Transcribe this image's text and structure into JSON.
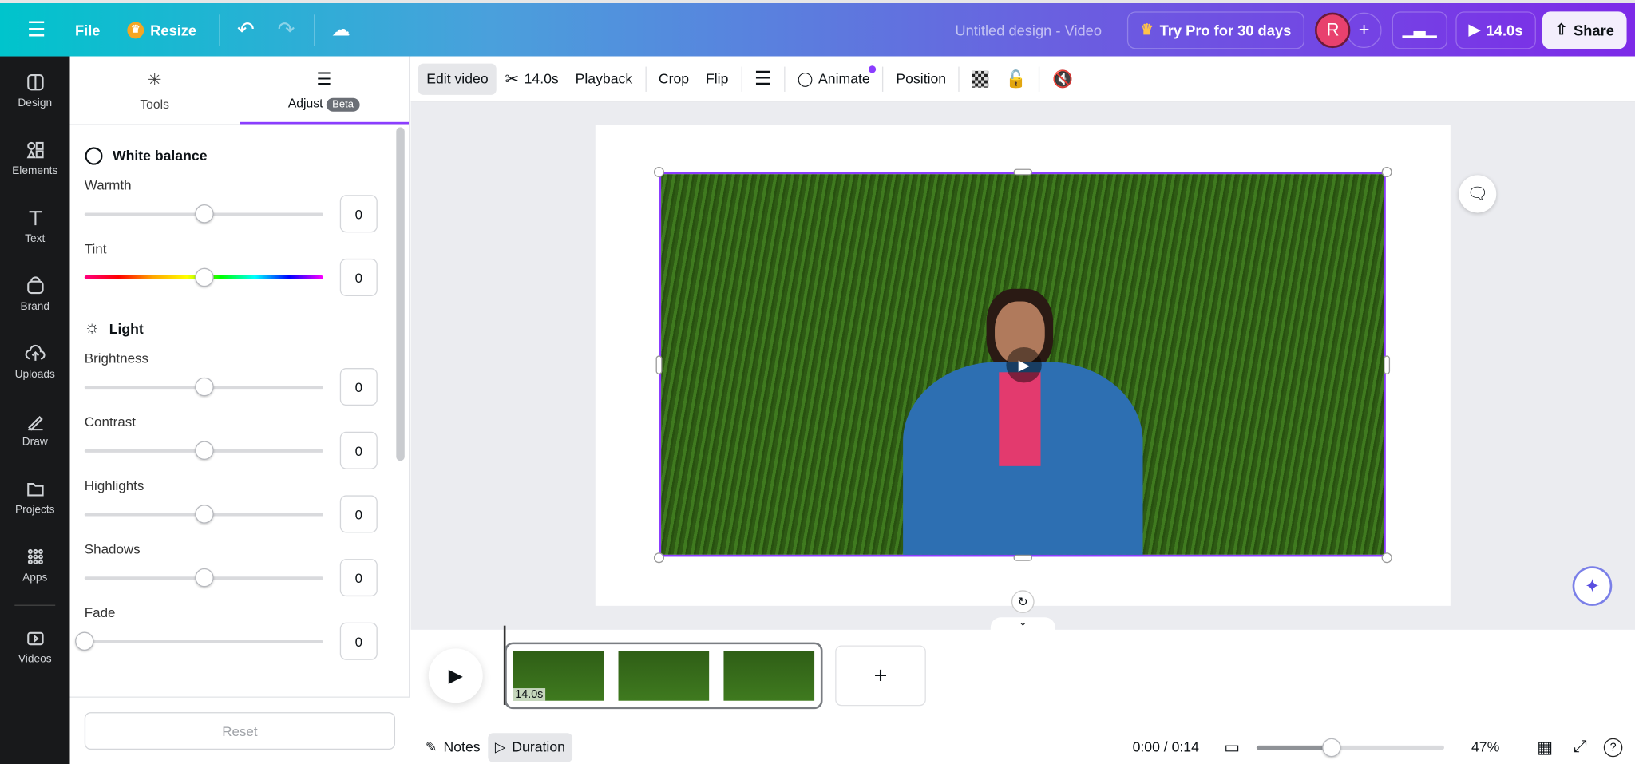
{
  "topbar": {
    "menu_icon": "hamburger-icon",
    "file": "File",
    "resize": "Resize",
    "title": "Untitled design - Video",
    "try_pro": "Try Pro for 30 days",
    "avatar_initial": "R",
    "play_duration": "14.0s",
    "share": "Share"
  },
  "rail": [
    {
      "label": "Design",
      "icon": "design-icon"
    },
    {
      "label": "Elements",
      "icon": "elements-icon"
    },
    {
      "label": "Text",
      "icon": "text-icon"
    },
    {
      "label": "Brand",
      "icon": "brand-icon"
    },
    {
      "label": "Uploads",
      "icon": "upload-icon"
    },
    {
      "label": "Draw",
      "icon": "draw-icon"
    },
    {
      "label": "Projects",
      "icon": "folder-icon"
    },
    {
      "label": "Apps",
      "icon": "apps-icon"
    },
    {
      "label": "Videos",
      "icon": "video-icon"
    }
  ],
  "panel": {
    "tabs": [
      {
        "label": "Tools"
      },
      {
        "label": "Adjust",
        "badge": "Beta"
      }
    ],
    "white_balance": "White balance",
    "light": "Light",
    "sliders": [
      {
        "label": "Warmth",
        "value": "0",
        "level": 0.5
      },
      {
        "label": "Tint",
        "value": "0",
        "level": 0.5
      },
      {
        "label": "Brightness",
        "value": "0",
        "level": 0.5
      },
      {
        "label": "Contrast",
        "value": "0",
        "level": 0.5
      },
      {
        "label": "Highlights",
        "value": "0",
        "level": 0.5
      },
      {
        "label": "Shadows",
        "value": "0",
        "level": 0.5
      },
      {
        "label": "Fade",
        "value": "0",
        "level": 0
      }
    ],
    "reset": "Reset"
  },
  "context_toolbar": {
    "edit_video": "Edit video",
    "trim_duration": "14.0s",
    "playback": "Playback",
    "crop": "Crop",
    "flip": "Flip",
    "animate": "Animate",
    "position": "Position"
  },
  "timeline": {
    "clip_duration": "14.0s"
  },
  "footer": {
    "notes": "Notes",
    "duration": "Duration",
    "time": "0:00 / 0:14",
    "zoom": "47%",
    "zoom_level": 0.4
  },
  "colors": {
    "accent": "#8b3dff",
    "avatar": "#e8416e"
  }
}
